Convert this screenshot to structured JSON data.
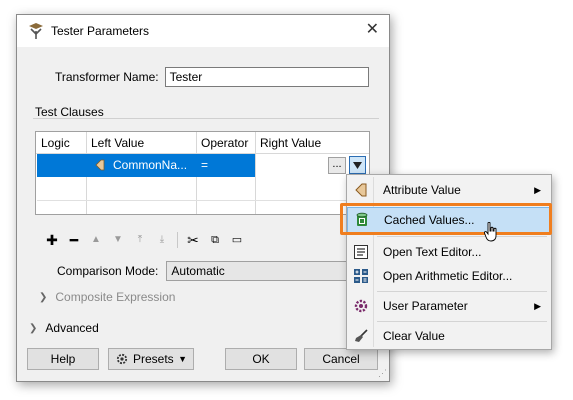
{
  "window": {
    "title": "Tester Parameters",
    "close_glyph": "✕"
  },
  "transformer": {
    "label": "Transformer Name:",
    "value": "Tester"
  },
  "test_clauses": {
    "group_label": "Test Clauses",
    "columns": [
      "Logic",
      "Left Value",
      "Operator",
      "Right Value"
    ],
    "rows": [
      {
        "logic": "",
        "left_value": "CommonNa...",
        "operator": "=",
        "right_value": ""
      }
    ],
    "ellipsis_label": "..."
  },
  "toolbar": {
    "icons": [
      "add-icon",
      "remove-icon",
      "move-up-icon",
      "move-down-icon",
      "move-top-icon",
      "move-bottom-icon",
      "cut-icon",
      "copy-icon",
      "paste-icon"
    ]
  },
  "comparison_mode": {
    "label": "Comparison Mode:",
    "value": "Automatic"
  },
  "composite_expression": {
    "label": "Composite Expression"
  },
  "advanced": {
    "label": "Advanced"
  },
  "buttons": {
    "help": "Help",
    "presets": "Presets",
    "ok": "OK",
    "cancel": "Cancel"
  },
  "context_menu": {
    "items": [
      {
        "label": "Attribute Value",
        "submenu": true,
        "icon": "attribute-icon"
      },
      {
        "label": "Cached Values...",
        "submenu": false,
        "icon": "cylinder-icon",
        "highlighted": true
      },
      {
        "label": "Open Text Editor...",
        "submenu": false,
        "icon": "text-editor-icon"
      },
      {
        "label": "Open Arithmetic Editor...",
        "submenu": false,
        "icon": "calculator-icon"
      },
      {
        "label": "User Parameter",
        "submenu": true,
        "icon": "gear-icon"
      },
      {
        "label": "Clear Value",
        "submenu": false,
        "icon": "broom-icon"
      }
    ]
  },
  "colors": {
    "selection": "#0078d7",
    "callout": "#f07e1e",
    "menu_highlight": "#c5e0f6"
  }
}
